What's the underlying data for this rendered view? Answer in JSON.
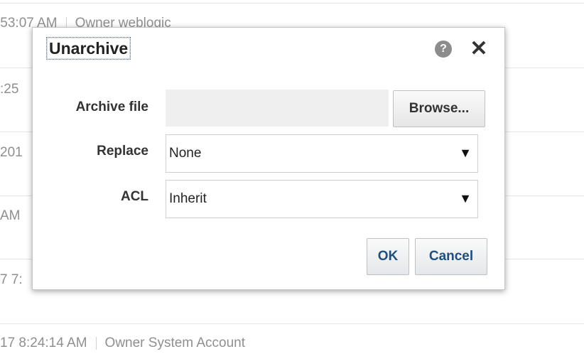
{
  "background_list": {
    "rows": [
      {
        "time": ":53:07 AM",
        "owner": "Owner weblogic"
      },
      {
        "time": ":25",
        "owner": ""
      },
      {
        "time": "201",
        "owner": ""
      },
      {
        "time": "AM",
        "owner": ""
      },
      {
        "time": "7 7:",
        "owner": ""
      },
      {
        "time": "17 8:24:14 AM",
        "owner": "Owner System Account"
      }
    ]
  },
  "dialog": {
    "title": "Unarchive",
    "help_icon": "help-icon",
    "help_glyph": "?",
    "close_icon": "close-icon",
    "close_glyph": "✕",
    "archive_file": {
      "label": "Archive file",
      "value": "",
      "browse_label": "Browse..."
    },
    "replace": {
      "label": "Replace",
      "selected": "None"
    },
    "acl": {
      "label": "ACL",
      "selected": "Inherit"
    },
    "dropdown_arrow": "▼",
    "ok_label": "OK",
    "cancel_label": "Cancel"
  },
  "colors": {
    "button_text": "#1f4f80",
    "muted_text": "#8f8f8f",
    "title_focus": "#2b6cc4"
  }
}
